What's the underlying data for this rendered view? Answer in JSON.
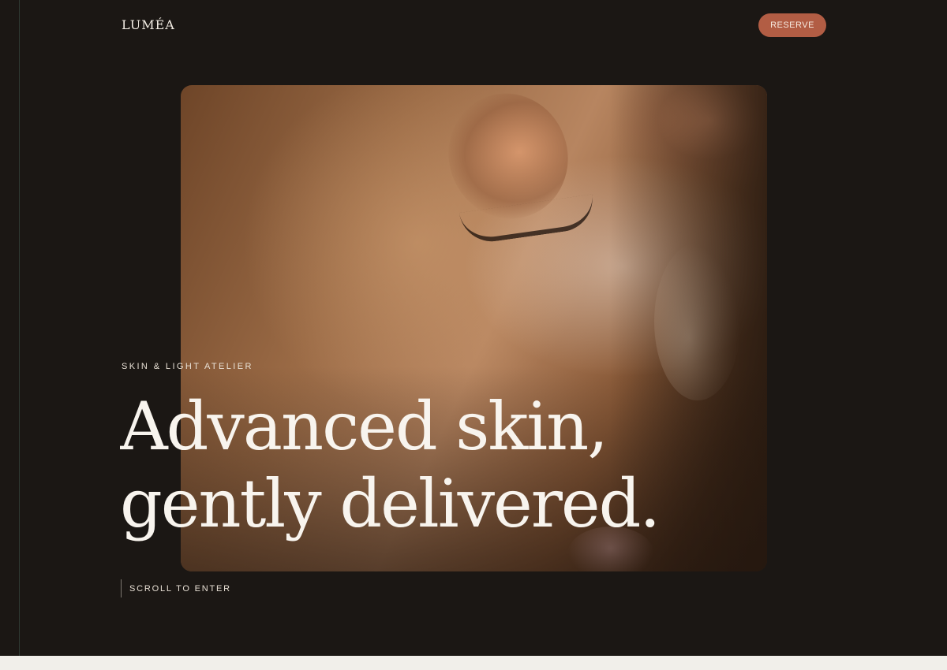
{
  "header": {
    "logo": "LUMÉA",
    "reserve_label": "RESERVE"
  },
  "hero": {
    "eyebrow": "SKIN & LIGHT ATELIER",
    "headline_line1": "Advanced skin,",
    "headline_line2": "gently delivered.",
    "scroll_label": "SCROLL TO ENTER"
  },
  "colors": {
    "background": "#1b1714",
    "accent": "#b25d44",
    "text": "#f8f4ee",
    "footer": "#f1efea"
  }
}
